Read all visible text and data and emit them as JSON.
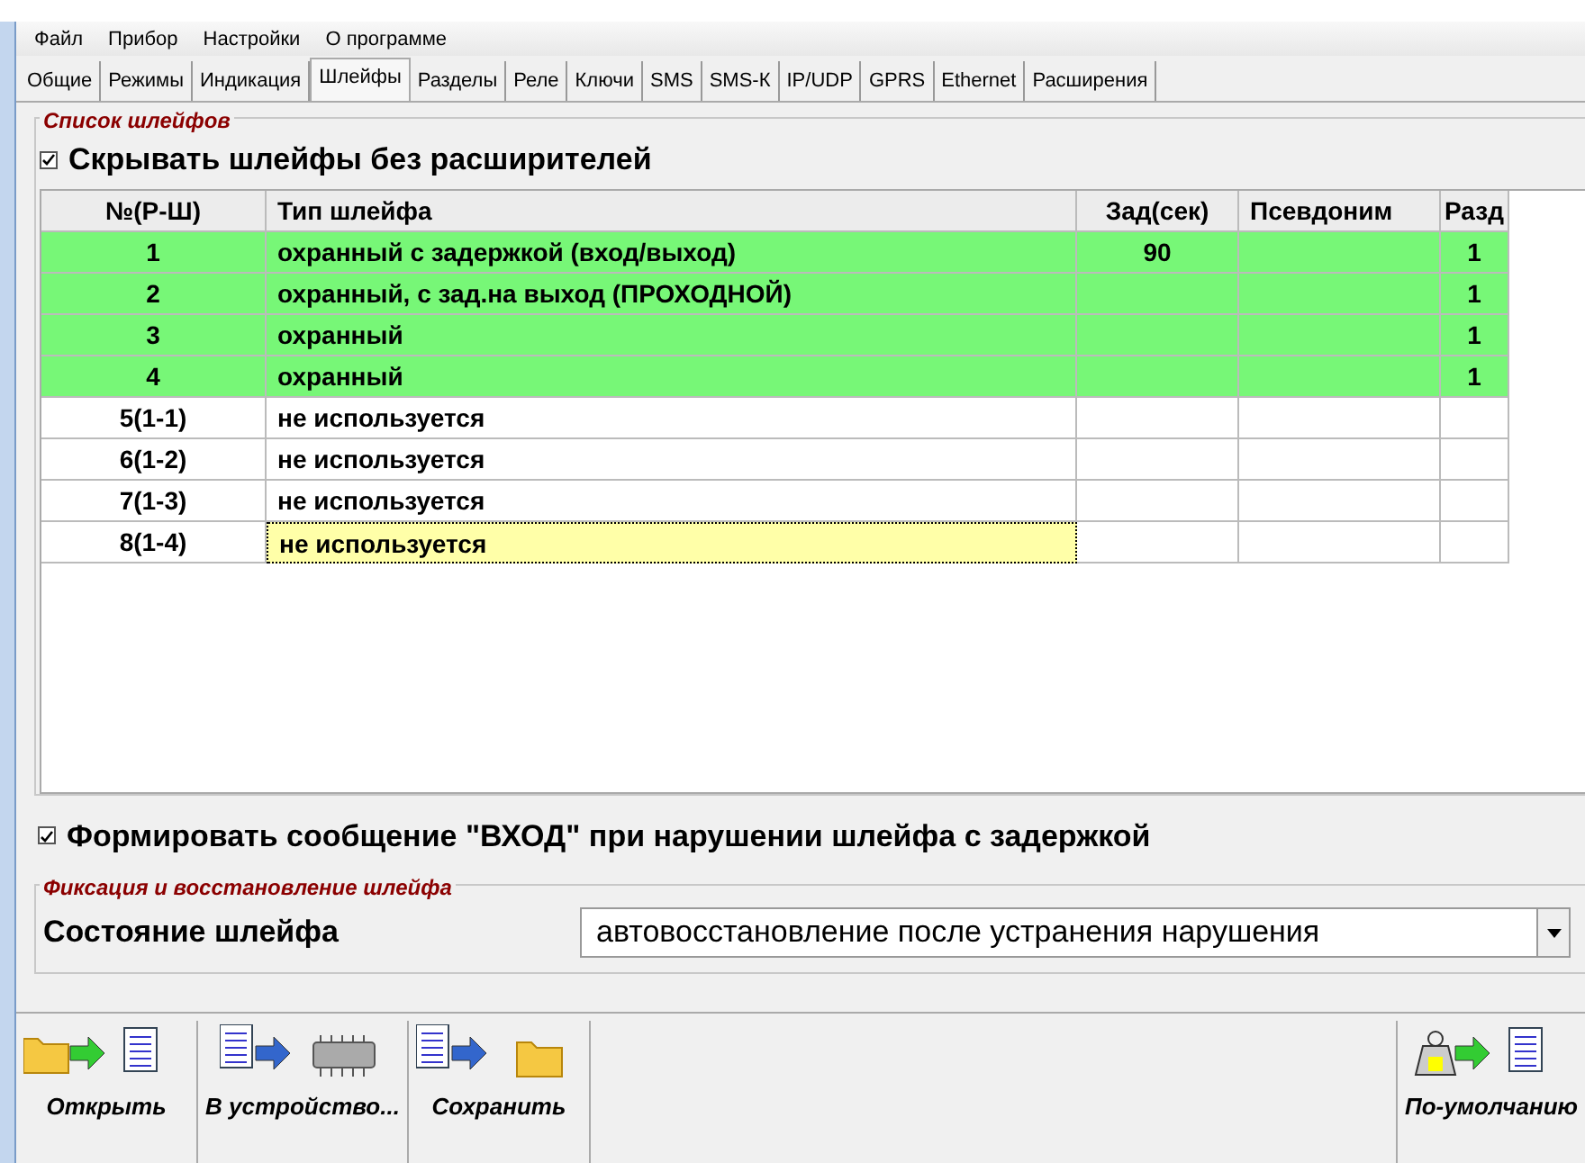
{
  "menu": [
    "Файл",
    "Прибор",
    "Настройки",
    "О программе"
  ],
  "tabs": [
    {
      "label": "Общие",
      "selected": false
    },
    {
      "label": "Режимы",
      "selected": false
    },
    {
      "label": "Индикация",
      "selected": false
    },
    {
      "label": "Шлейфы",
      "selected": true
    },
    {
      "label": "Разделы",
      "selected": false
    },
    {
      "label": "Реле",
      "selected": false
    },
    {
      "label": "Ключи",
      "selected": false
    },
    {
      "label": "SMS",
      "selected": false
    },
    {
      "label": "SMS-К",
      "selected": false
    },
    {
      "label": "IP/UDP",
      "selected": false
    },
    {
      "label": "GPRS",
      "selected": false
    },
    {
      "label": "Ethernet",
      "selected": false
    },
    {
      "label": "Расширения",
      "selected": false
    }
  ],
  "loops_group": {
    "title": "Список шлейфов",
    "hide_checkbox": {
      "label": "Скрывать шлейфы без расширителей",
      "checked": true
    }
  },
  "table": {
    "columns": [
      "№(Р-Ш)",
      "Тип шлейфа",
      "Зад(сек)",
      "Псевдоним",
      "Разд"
    ],
    "rows": [
      {
        "cells": [
          "1",
          "охранный с задержкой (вход/выход)",
          "90",
          "",
          "1"
        ],
        "used": true,
        "selected": false
      },
      {
        "cells": [
          "2",
          "охранный, с зад.на выход (ПРОХОДНОЙ)",
          "",
          "",
          "1"
        ],
        "used": true,
        "selected": false
      },
      {
        "cells": [
          "3",
          "охранный",
          "",
          "",
          "1"
        ],
        "used": true,
        "selected": false
      },
      {
        "cells": [
          "4",
          "охранный",
          "",
          "",
          "1"
        ],
        "used": true,
        "selected": false
      },
      {
        "cells": [
          "5(1-1)",
          "не используется",
          "",
          "",
          ""
        ],
        "used": false,
        "selected": false
      },
      {
        "cells": [
          "6(1-2)",
          "не используется",
          "",
          "",
          ""
        ],
        "used": false,
        "selected": false
      },
      {
        "cells": [
          "7(1-3)",
          "не используется",
          "",
          "",
          ""
        ],
        "used": false,
        "selected": false
      },
      {
        "cells": [
          "8(1-4)",
          "не используется",
          "",
          "",
          ""
        ],
        "used": false,
        "selected": true
      }
    ]
  },
  "entry_checkbox": {
    "label": "Формировать сообщение \"ВХОД\" при нарушении шлейфа с задержкой",
    "checked": true
  },
  "fix_group": {
    "title": "Фиксация и восстановление шлейфа",
    "label": "Состояние шлейфа",
    "value": "автовосстановление после устранения нарушения"
  },
  "toolbar": [
    {
      "label": "Открыть",
      "kind": "open"
    },
    {
      "label": "В устройство...",
      "kind": "device"
    },
    {
      "label": "Сохранить",
      "kind": "save"
    },
    {
      "label": "По-умолчанию",
      "kind": "defaults"
    }
  ]
}
